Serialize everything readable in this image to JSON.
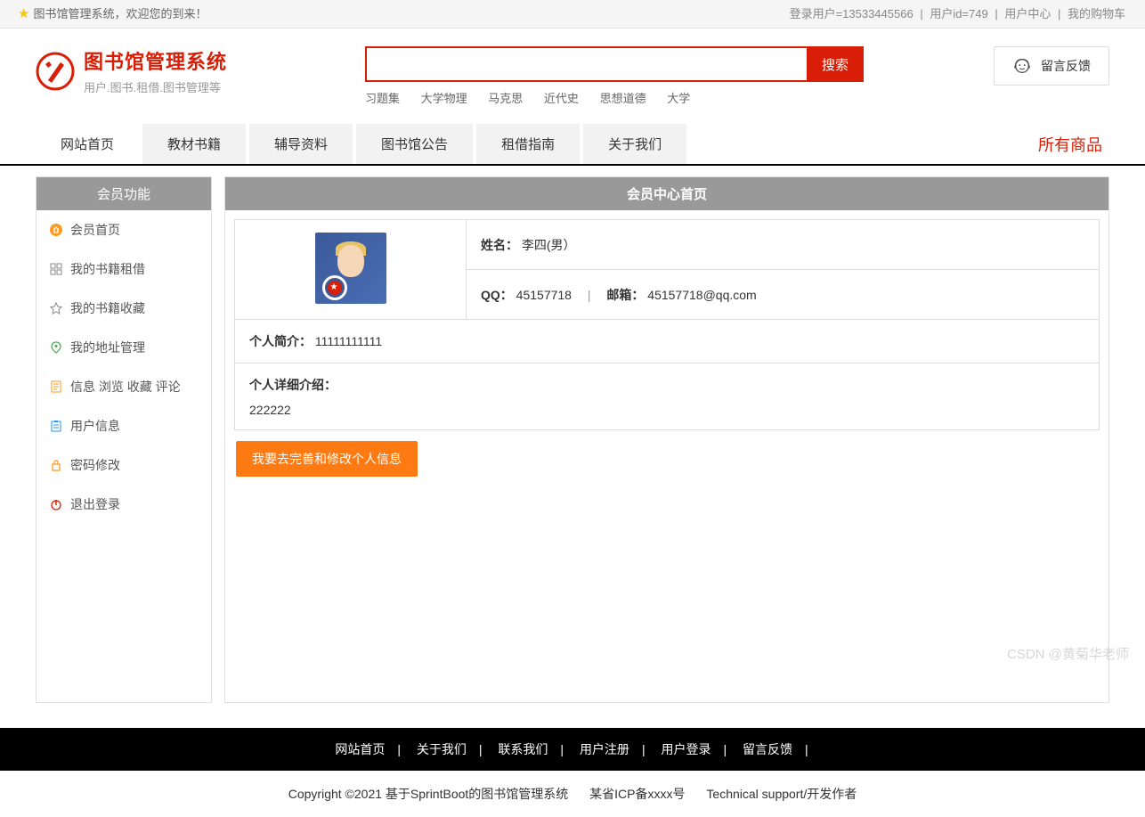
{
  "topbar": {
    "welcome": "图书馆管理系统，欢迎您的到来！",
    "login_user_label": "登录用户=13533445566",
    "user_id_label": "用户id=749",
    "user_center": "用户中心",
    "my_cart": "我的购物车"
  },
  "header": {
    "title": "图书馆管理系统",
    "subtitle": "用户.图书.租借.图书管理等",
    "search_button": "搜索",
    "search_value": "",
    "hot_keywords": [
      "习题集",
      "大学物理",
      "马克思",
      "近代史",
      "思想道德",
      "大学"
    ],
    "feedback": "留言反馈"
  },
  "nav": {
    "items": [
      "网站首页",
      "教材书籍",
      "辅导资料",
      "图书馆公告",
      "租借指南",
      "关于我们"
    ],
    "right": "所有商品"
  },
  "sidebar": {
    "title": "会员功能",
    "items": [
      {
        "label": "会员首页"
      },
      {
        "label": "我的书籍租借"
      },
      {
        "label": "我的书籍收藏"
      },
      {
        "label": "我的地址管理"
      },
      {
        "label": "信息 浏览 收藏 评论"
      },
      {
        "label": "用户信息"
      },
      {
        "label": "密码修改"
      },
      {
        "label": "退出登录"
      }
    ]
  },
  "panel": {
    "title": "会员中心首页",
    "name_label": "姓名：",
    "name_value": "李四(男）",
    "qq_label": "QQ：",
    "qq_value": "45157718",
    "email_label": "邮箱：",
    "email_value": "45157718@qq.com",
    "intro_label": "个人简介：",
    "intro_value": "11111111111",
    "detail_label": "个人详细介绍：",
    "detail_value": "222222",
    "edit_button": "我要去完善和修改个人信息"
  },
  "footer": {
    "links": [
      "网站首页",
      "关于我们",
      "联系我们",
      "用户注册",
      "用户登录",
      "留言反馈"
    ],
    "copyright": "Copyright ©2021 基于SprintBoot的图书馆管理系统",
    "icp": "某省ICP备xxxx号",
    "support": "Technical support/开发作者"
  },
  "watermark": "CSDN @黄菊华老师"
}
